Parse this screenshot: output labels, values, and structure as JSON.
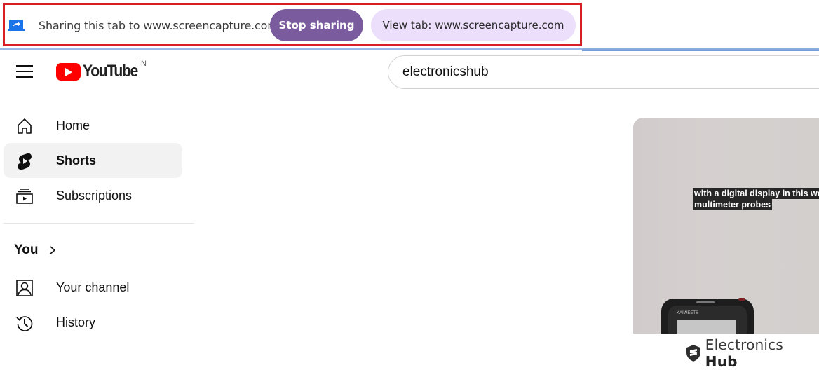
{
  "share_bar": {
    "icon": "screen-share-icon",
    "message": "Sharing this tab to www.screencapture.com",
    "stop_label": "Stop sharing",
    "view_label": "View tab: www.screencapture.com",
    "colors": {
      "stop_bg": "#7a5c9e",
      "view_bg": "#ecdffb",
      "highlight": "#d81f26"
    }
  },
  "header": {
    "menu_icon": "hamburger-menu-icon",
    "logo_text": "YouTube",
    "country_code": "IN",
    "search_value": "electronicshub"
  },
  "sidebar": {
    "items": [
      {
        "label": "Home",
        "icon": "home-icon",
        "active": false
      },
      {
        "label": "Shorts",
        "icon": "shorts-icon",
        "active": true
      },
      {
        "label": "Subscriptions",
        "icon": "subscriptions-icon",
        "active": false
      }
    ],
    "you_section": {
      "title": "You",
      "items": [
        {
          "label": "Your channel",
          "icon": "your-channel-icon"
        },
        {
          "label": "History",
          "icon": "history-icon"
        }
      ]
    }
  },
  "video": {
    "caption_lines": [
      "with a digital display in this we",
      "multimeter probes"
    ],
    "device_brand": "KAIWEETS"
  },
  "watermark": {
    "text_light": "Electronics ",
    "text_bold": "Hub"
  }
}
